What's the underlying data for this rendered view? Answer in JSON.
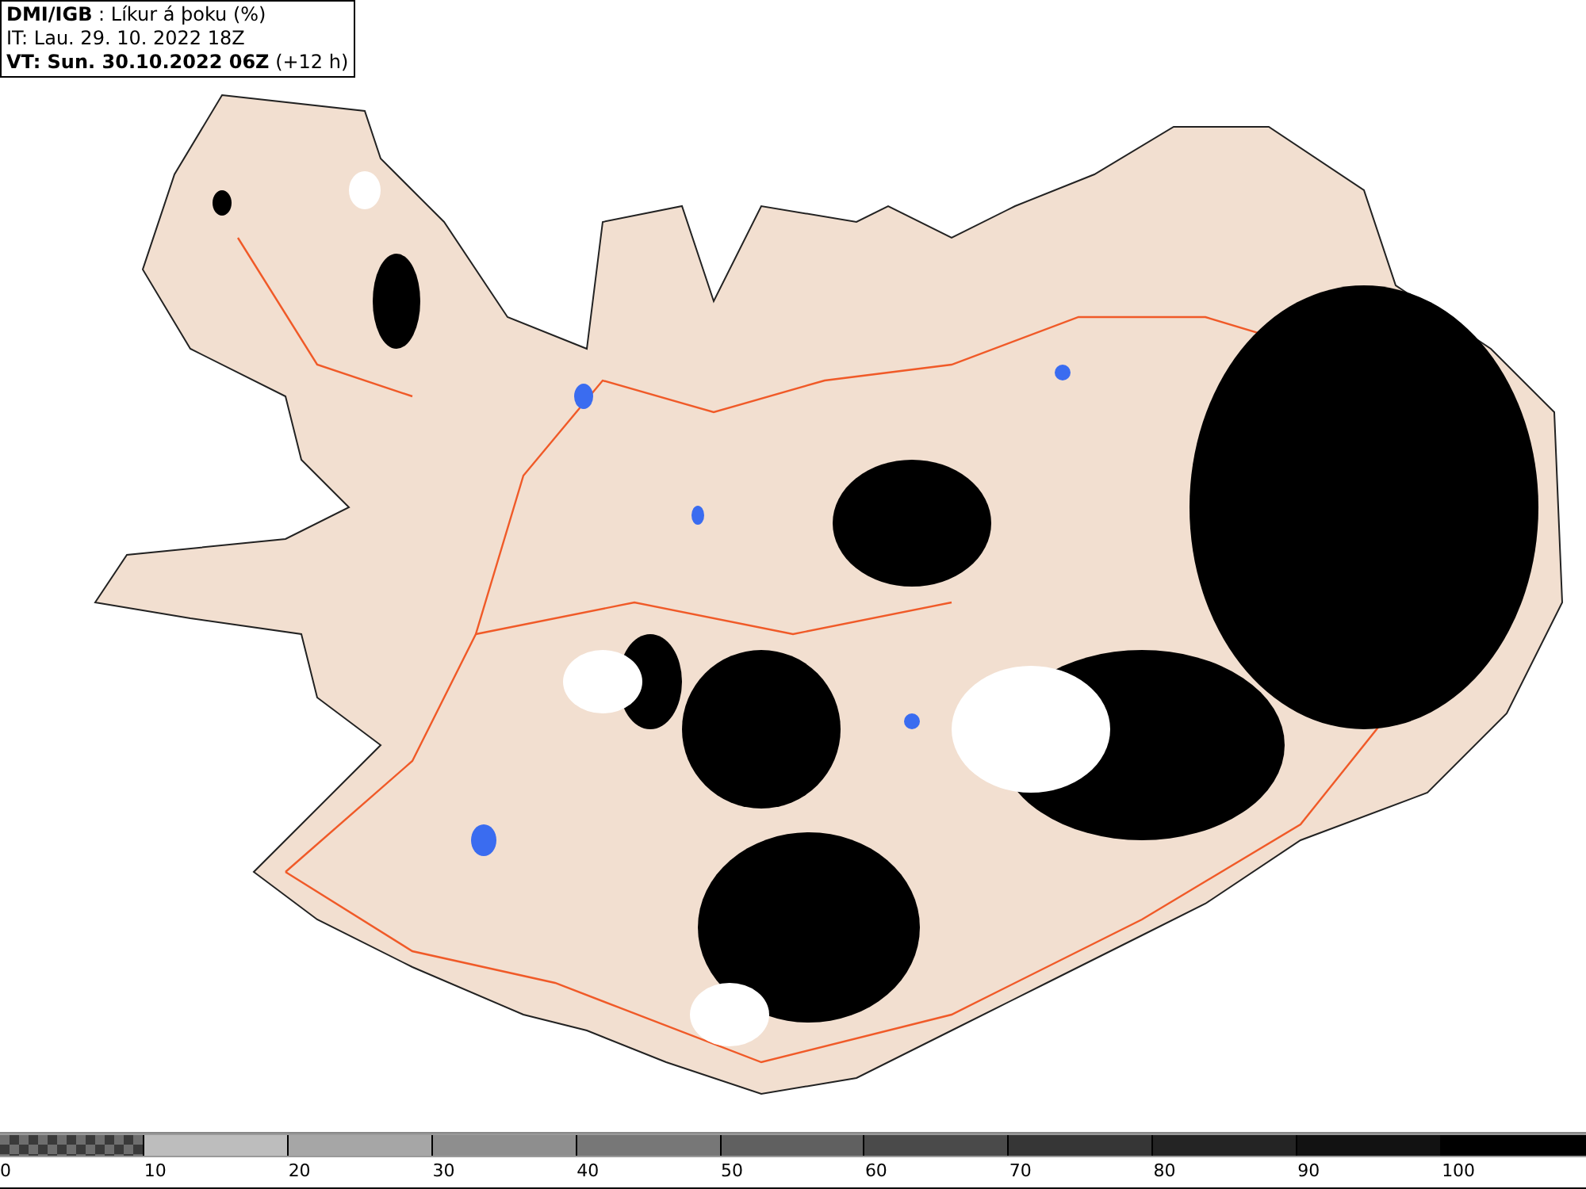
{
  "header": {
    "lines": [
      "**DMI/IGB** : Líkur á þoku (%)",
      "IT: Lau. 29. 10. 2022 18Z",
      "**VT: Sun. 30.10.2022 06Z** (+12 h)"
    ]
  },
  "legend": {
    "segments": [
      {
        "kind": "checker",
        "color": "#6e6e6e",
        "label": "0"
      },
      {
        "kind": "solid",
        "color": "#bdbdbd",
        "label": "10"
      },
      {
        "kind": "solid",
        "color": "#a6a6a6",
        "label": "20"
      },
      {
        "kind": "solid",
        "color": "#8e8e8e",
        "label": "30"
      },
      {
        "kind": "solid",
        "color": "#777777",
        "label": "40"
      },
      {
        "kind": "solid",
        "color": "#606060",
        "label": "50"
      },
      {
        "kind": "solid",
        "color": "#4a4a4a",
        "label": "60"
      },
      {
        "kind": "solid",
        "color": "#363636",
        "label": "70"
      },
      {
        "kind": "solid",
        "color": "#242424",
        "label": "80"
      },
      {
        "kind": "solid",
        "color": "#121212",
        "label": "90"
      },
      {
        "kind": "solid",
        "color": "#000000",
        "label": "100"
      }
    ]
  }
}
